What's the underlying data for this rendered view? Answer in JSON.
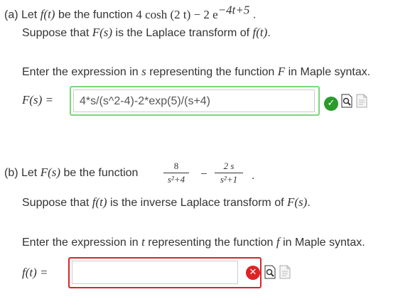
{
  "part_a": {
    "intro": "(a) Let",
    "f_of_t": "f(t)",
    "be_function": "be the function",
    "function_expr_main": "4 cosh (2 t) − 2 e",
    "function_expr_exp": "−4t+5",
    "period": ".",
    "suppose_pre": "Suppose that",
    "F_of_s": "F(s)",
    "suppose_mid": "is the Laplace transform of",
    "f_of_t_2": "f(t)",
    "suppose_end": ".",
    "enter_pre": "Enter the expression in",
    "var": "s",
    "enter_mid": "representing the function",
    "func": "F",
    "enter_end": "in Maple syntax.",
    "answer_label": "F(s) =",
    "answer_value": "4*s/(s^2-4)-2*exp(5)/(s+4)",
    "status": "correct"
  },
  "part_b": {
    "intro": "(b) Let",
    "F_of_s": "F(s)",
    "be_function": "be the function",
    "frac1_num": "8",
    "frac1_den": "s²+4",
    "minus": "−",
    "frac2_num": "2 s",
    "frac2_den": "s²+1",
    "period": ".",
    "suppose_pre": "Suppose that",
    "f_of_t": "f(t)",
    "suppose_mid": "is the inverse Laplace transform of",
    "F_of_s_2": "F(s)",
    "suppose_end": ".",
    "enter_pre": "Enter the expression in",
    "var": "t",
    "enter_mid": "representing the function",
    "func": "f",
    "enter_end": "in Maple syntax.",
    "answer_label": "f(t) =",
    "answer_value": "",
    "status": "incorrect"
  },
  "icons": [
    "check-icon",
    "preview-icon",
    "help-doc-icon",
    "x-icon"
  ],
  "colors": {
    "correct_border": "#7cd67c",
    "incorrect_border": "#d6262b",
    "check_bg": "#2a9b2a",
    "x_bg": "#e02323"
  }
}
